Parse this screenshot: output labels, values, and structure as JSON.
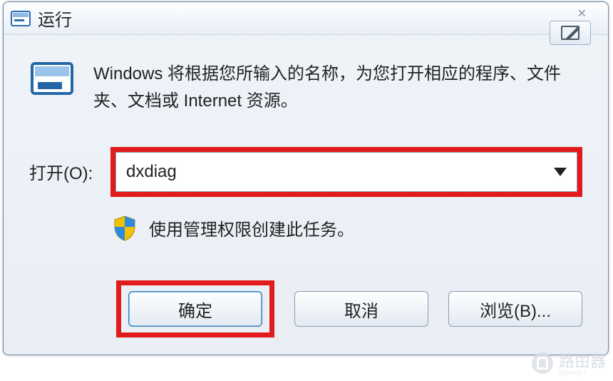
{
  "window": {
    "title": "运行"
  },
  "intro": {
    "text": "Windows 将根据您所输入的名称，为您打开相应的程序、文件夹、文档或 Internet 资源。"
  },
  "open": {
    "label": "打开(O):",
    "value": "dxdiag"
  },
  "admin": {
    "text": "使用管理权限创建此任务。"
  },
  "buttons": {
    "ok": "确定",
    "cancel": "取消",
    "browse": "浏览(B)..."
  },
  "watermark": {
    "text": "路由器",
    "sub": "luyouqi.c"
  },
  "highlights": {
    "input": "#E11B1B",
    "ok_button": "#E11B1B"
  }
}
